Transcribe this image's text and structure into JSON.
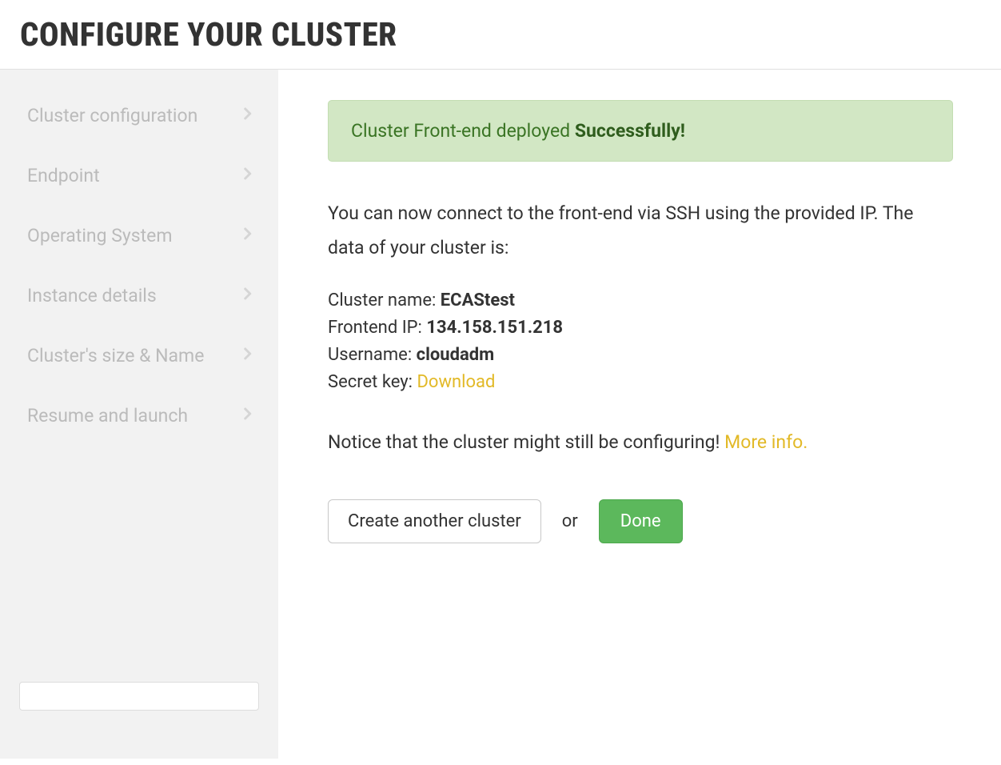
{
  "header": {
    "title": "CONFIGURE YOUR CLUSTER"
  },
  "sidebar": {
    "items": [
      {
        "label": "Cluster configuration"
      },
      {
        "label": "Endpoint"
      },
      {
        "label": "Operating System"
      },
      {
        "label": "Instance details"
      },
      {
        "label": "Cluster's size & Name"
      },
      {
        "label": "Resume and launch"
      }
    ]
  },
  "main": {
    "alert_prefix": "Cluster Front-end deployed ",
    "alert_success": "Successfully!",
    "intro": "You can now connect to the front-end via SSH using the provided IP. The data of your cluster is:",
    "cluster_name_label": "Cluster name: ",
    "cluster_name_value": "ECAStest",
    "frontend_ip_label": "Frontend IP: ",
    "frontend_ip_value": "134.158.151.218",
    "username_label": "Username: ",
    "username_value": "cloudadm",
    "secret_key_label": "Secret key: ",
    "secret_key_link": "Download",
    "notice_text": "Notice that the cluster might still be configuring! ",
    "more_info": "More info.",
    "create_another_label": "Create another cluster",
    "or_label": "or",
    "done_label": "Done"
  }
}
